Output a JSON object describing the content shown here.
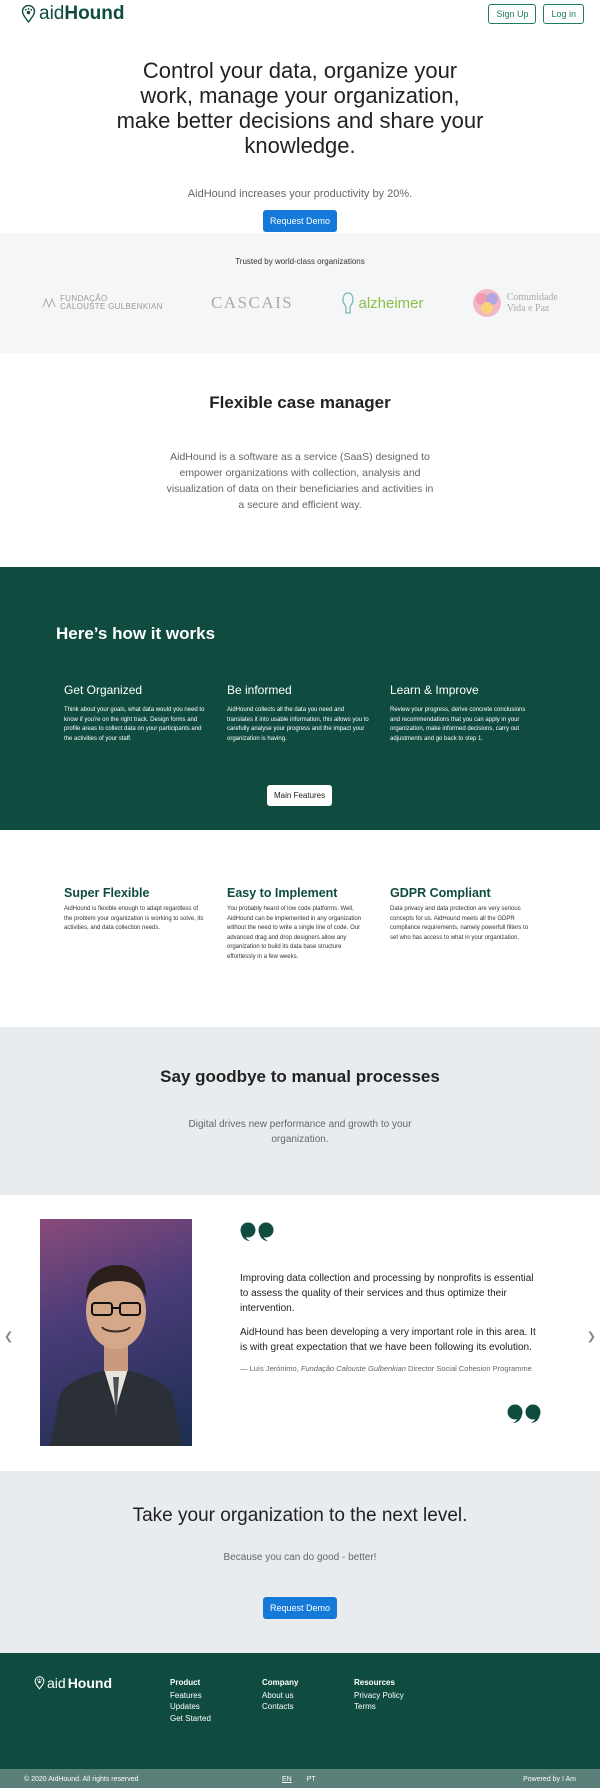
{
  "header": {
    "logo_light": "aid",
    "logo_bold": "Hound",
    "signup_label": "Sign Up",
    "login_label": "Log in"
  },
  "hero": {
    "title": "Control your data, organize your work, manage your organization, make better decisions and share your knowledge.",
    "subtitle": "AidHound increases your productivity by 20%.",
    "cta_label": "Request Demo"
  },
  "trusted": {
    "title": "Trusted by world-class organizations",
    "logos": {
      "gulbenkian_line1": "FUNDAÇÃO",
      "gulbenkian_line2": "CALOUSTE GULBENKIAN",
      "cascais": "CASCAIS",
      "alzheimer": "alzheimer",
      "vida_line1": "Comunidade",
      "vida_line2": "Vida e Paz"
    }
  },
  "flexible": {
    "title": "Flexible case manager",
    "text": "AidHound is a software as a service (SaaS) designed to empower organizations with collection, analysis and visualization of data on their beneficiaries and activities in a secure and efficient way."
  },
  "how": {
    "title": "Here’s how it works",
    "cols": [
      {
        "title": "Get Organized",
        "text": "Think about your goals, what data would you need to know if you're on the right track. Design forms and profile areas to collect data on your participants and the activities of your staff."
      },
      {
        "title": "Be informed",
        "text": "AidHound collects all the data you need and translates it into usable information, this allows you to carefully analyse your progress and the impact your organization is having."
      },
      {
        "title": "Learn & Improve",
        "text": "Review your progress, derive concrete conclusions and recommendations that you can apply in your organization, make informed decisions, carry out adjustments and go back to step 1."
      }
    ],
    "button_label": "Main Features"
  },
  "features": [
    {
      "title": "Super Flexible",
      "text": "AidHound is flexible enough to adapt regardless of the problem your organization is working to solve, its activities, and data collection needs."
    },
    {
      "title": "Easy to Implement",
      "text": "You probably heard of low code platforms. Well, AidHound can be implemented in any organization without the need to write a single line of code. Our advanced drag and drop designers allow any organization to build its data base structure effortlessly in a few weeks."
    },
    {
      "title": "GDPR Compliant",
      "text": "Data privacy and data protection are very serious concepts for us. AidHound meets all the GDPR compliance requirements, namely powerfull filters to set who has access to what in your organization."
    }
  ],
  "goodbye": {
    "title": "Say goodbye to manual processes",
    "text": "Digital drives new performance and growth to your organization."
  },
  "testimonial": {
    "p1": "Improving data collection and processing by nonprofits is essential to assess the quality of their services and thus optimize their intervention.",
    "p2": "AidHound has been developing a very important role in this area. It is with great expectation that we have been following its evolution.",
    "author_name": "— Luís Jerónimo, ",
    "author_org": "Fundação Calouste Gulbenkian",
    "author_role": " Director Social Cohesion Programme"
  },
  "nextlevel": {
    "title": "Take your organization to the next level.",
    "subtitle": "Because you can do good - better!",
    "cta_label": "Request Demo"
  },
  "footer": {
    "logo_light": "aid",
    "logo_bold": "Hound",
    "product": {
      "title": "Product",
      "links": [
        "Features",
        "Updates",
        "Get Started"
      ]
    },
    "company": {
      "title": "Company",
      "links": [
        "About us",
        "Contacts"
      ]
    },
    "resources": {
      "title": "Resources",
      "links": [
        "Privacy Policy",
        "Terms"
      ]
    },
    "copyright": "© 2020 AidHound. All rights reserved",
    "lang_en": "EN",
    "lang_pt": "PT",
    "powered": "Powered by I Am"
  },
  "colors": {
    "brand_green": "#0f4c3f",
    "accent_blue": "#1479d9",
    "footer_bar": "#5b7f79"
  },
  "icons": {
    "logo": "paw-pin-icon",
    "arrows": [
      "chevron-left-icon",
      "chevron-right-icon"
    ],
    "quotes": [
      "quote-open-icon",
      "quote-close-icon"
    ]
  }
}
